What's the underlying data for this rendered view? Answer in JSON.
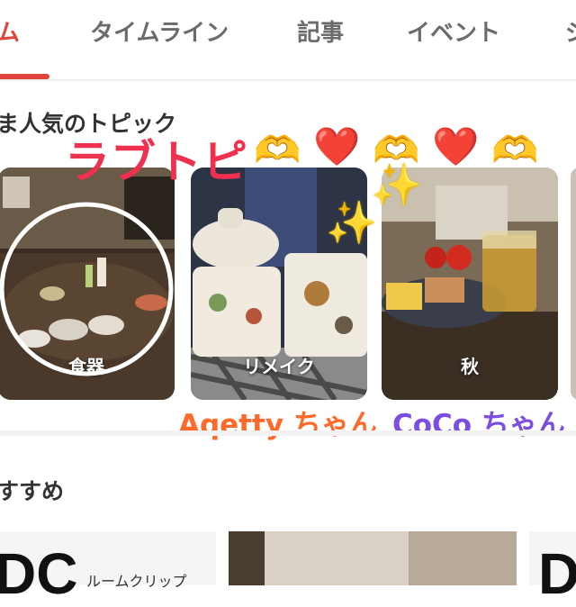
{
  "tabs": [
    {
      "label": "ム"
    },
    {
      "label": "タイムライン"
    },
    {
      "label": "記事"
    },
    {
      "label": "イベント"
    },
    {
      "label": "ジ"
    }
  ],
  "section_popular": {
    "title": "ま人気のトピック"
  },
  "overlay": {
    "love_text": "ラブトピ",
    "emoji_hands": "🫶",
    "emoji_heart": "❤️",
    "sparkle": "✨",
    "name1": "Aqetty ちゃん",
    "name2": "CoCo ちゃん",
    "name1_color": "#ff6a2b",
    "name2_color": "#7b4de0"
  },
  "topics": [
    {
      "label": "食器"
    },
    {
      "label": "リメイク"
    },
    {
      "label": "秋"
    }
  ],
  "section_recommend": {
    "title": "すすめ"
  },
  "bottom": {
    "text_big": "DC",
    "text_small": "ルームクリップ",
    "text_right": "D"
  },
  "colors": {
    "accent": "#e0443b",
    "love": "#f0304f"
  }
}
